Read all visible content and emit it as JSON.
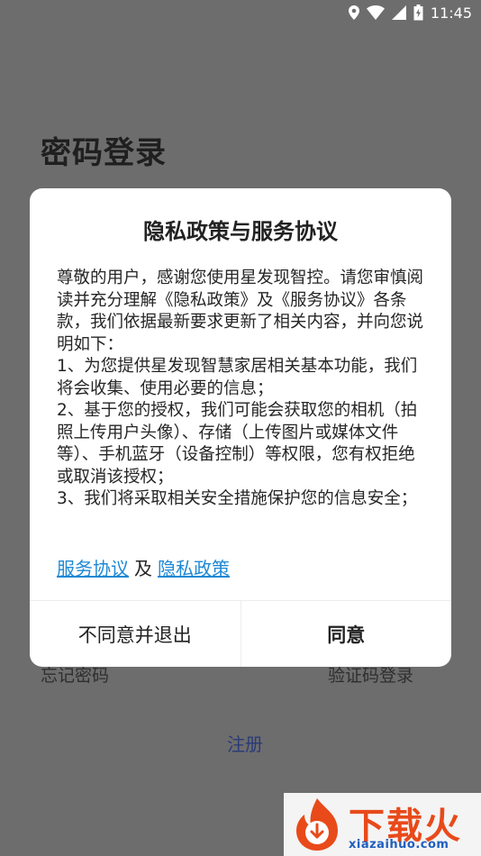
{
  "status_bar": {
    "time": "11:45",
    "icons": [
      "location-icon",
      "wifi-icon",
      "signal-icon",
      "battery-icon"
    ]
  },
  "background": {
    "title": "密码登录",
    "forgot_password": "忘记密码",
    "code_login": "验证码登录",
    "register": "注册"
  },
  "dialog": {
    "title": "隐私政策与服务协议",
    "intro": "尊敬的用户，感谢您使用星发现智控。请您审慎阅读并充分理解《隐私政策》及《服务协议》各条款，我们依据最新要求更新了相关内容，并向您说明如下：",
    "item1": "1、为您提供星发现智慧家居相关基本功能，我们将会收集、使用必要的信息；",
    "item2": "2、基于您的授权，我们可能会获取您的相机（拍照上传用户头像）、存储（上传图片或媒体文件等）、手机蓝牙（设备控制）等权限，您有权拒绝或取消该授权；",
    "item3": "3、我们将采取相关安全措施保护您的信息安全；",
    "link_service": "服务协议",
    "link_conj": "及",
    "link_privacy": "隐私政策",
    "btn_disagree": "不同意并退出",
    "btn_agree": "同意"
  },
  "watermark": {
    "text": "下载火",
    "url": "xiazaihuo.com"
  },
  "colors": {
    "overlay_bg": "#6d6d6d",
    "link": "#1e88d6",
    "register": "#2a3b78",
    "watermark_red": "#e84a1a",
    "watermark_blue": "#1f5fbf"
  }
}
